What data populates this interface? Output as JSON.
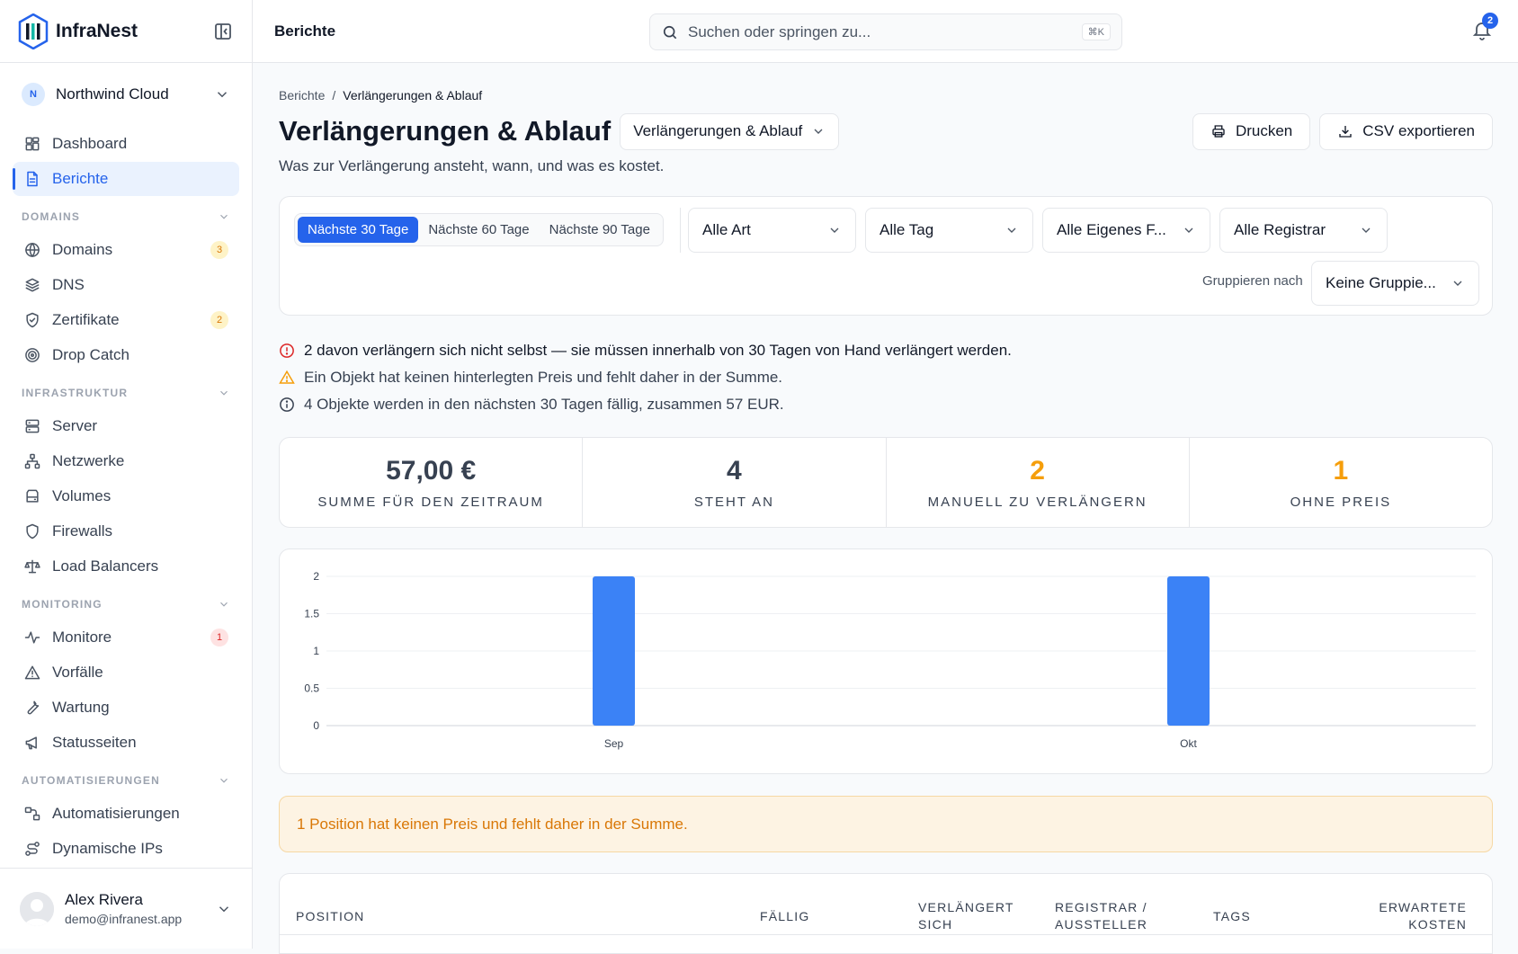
{
  "app": {
    "brand": "InfraNest",
    "org": "Northwind Cloud",
    "org_initial": "N"
  },
  "sidebar": {
    "top": [
      {
        "label": "Dashboard",
        "icon": "dashboard-icon"
      },
      {
        "label": "Berichte",
        "icon": "report-icon",
        "active": true
      }
    ],
    "sections": [
      {
        "title": "DOMAINS",
        "items": [
          {
            "label": "Domains",
            "icon": "globe-icon",
            "badge": "3",
            "badge_color": "amber"
          },
          {
            "label": "DNS",
            "icon": "layers-icon"
          },
          {
            "label": "Zertifikate",
            "icon": "shield-check-icon",
            "badge": "2",
            "badge_color": "amber"
          },
          {
            "label": "Drop Catch",
            "icon": "target-icon"
          }
        ]
      },
      {
        "title": "INFRASTRUKTUR",
        "items": [
          {
            "label": "Server",
            "icon": "server-icon"
          },
          {
            "label": "Netzwerke",
            "icon": "network-icon"
          },
          {
            "label": "Volumes",
            "icon": "drive-icon"
          },
          {
            "label": "Firewalls",
            "icon": "shield-icon"
          },
          {
            "label": "Load Balancers",
            "icon": "scale-icon"
          }
        ]
      },
      {
        "title": "MONITORING",
        "items": [
          {
            "label": "Monitore",
            "icon": "activity-icon",
            "badge": "1",
            "badge_color": "red"
          },
          {
            "label": "Vorfälle",
            "icon": "warning-icon"
          },
          {
            "label": "Wartung",
            "icon": "wrench-icon"
          },
          {
            "label": "Statusseiten",
            "icon": "megaphone-icon"
          }
        ]
      },
      {
        "title": "AUTOMATISIERUNGEN",
        "items": [
          {
            "label": "Automatisierungen",
            "icon": "workflow-icon"
          },
          {
            "label": "Dynamische IPs",
            "icon": "route-icon"
          }
        ]
      }
    ]
  },
  "user": {
    "name": "Alex Rivera",
    "email": "demo@infranest.app"
  },
  "topbar": {
    "title": "Berichte",
    "search_placeholder": "Suchen oder springen zu...",
    "shortcut": "⌘K",
    "notifications": "2"
  },
  "page": {
    "breadcrumb": [
      "Berichte",
      "Verlängerungen & Ablauf"
    ],
    "title": "Verlängerungen & Ablauf",
    "report_select": "Verlängerungen & Ablauf",
    "subtitle": "Was zur Verlängerung ansteht, wann, und was es kostet.",
    "print_label": "Drucken",
    "export_label": "CSV exportieren"
  },
  "filters": {
    "ranges": [
      "Nächste 30 Tage",
      "Nächste 60 Tage",
      "Nächste 90 Tage"
    ],
    "active_range": 0,
    "selects": [
      "Alle Art",
      "Alle Tag",
      "Alle Eigenes F...",
      "Alle Registrar"
    ],
    "group_label": "Gruppieren nach",
    "group_value": "Keine Gruppie..."
  },
  "alerts": {
    "error": "2 davon verlängern sich nicht selbst — sie müssen innerhalb von 30 Tagen von Hand verlängert werden.",
    "warning": "Ein Objekt hat keinen hinterlegten Preis und fehlt daher in der Summe.",
    "info": "4 Objekte werden in den nächsten 30 Tagen fällig, zusammen 57 EUR."
  },
  "stats": [
    {
      "value": "57,00 €",
      "label": "SUMME FÜR DEN ZEITRAUM",
      "color": "#374151"
    },
    {
      "value": "4",
      "label": "STEHT AN",
      "color": "#374151"
    },
    {
      "value": "2",
      "label": "MANUELL ZU VERLÄNGERN",
      "color": "#f59e0b"
    },
    {
      "value": "1",
      "label": "OHNE PREIS",
      "color": "#f59e0b"
    }
  ],
  "chart_data": {
    "type": "bar",
    "categories": [
      "Sep",
      "Okt"
    ],
    "values": [
      2,
      2
    ],
    "ylim": [
      0,
      2
    ],
    "yticks": [
      "0",
      "0.5",
      "1",
      "1.5",
      "2"
    ],
    "grid": true,
    "color": "#3b82f6"
  },
  "notice": "1 Position hat keinen Preis und fehlt daher in der Summe.",
  "table": {
    "headers": [
      "POSITION",
      "FÄLLIG",
      "VERLÄNGERT SICH",
      "REGISTRAR / AUSSTELLER",
      "TAGS",
      "ERWARTETE KOSTEN"
    ]
  }
}
